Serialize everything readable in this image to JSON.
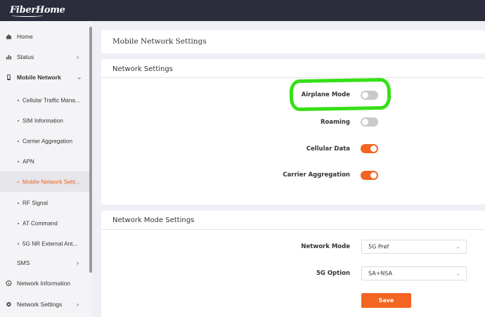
{
  "brand": {
    "logo_text": "FiberHome"
  },
  "sidebar": {
    "items": [
      {
        "label": "Home",
        "icon": "home-icon"
      },
      {
        "label": "Status",
        "icon": "bar-chart-icon"
      },
      {
        "label": "Mobile Network",
        "icon": "phone-icon"
      },
      {
        "label": "Network Information",
        "icon": "network-info-icon"
      },
      {
        "label": "Network Settings",
        "icon": "gear-icon"
      }
    ],
    "mobile_network_sub": [
      "Cellular Traffic Mana...",
      "SIM Information",
      "Carrier Aggregation",
      "APN",
      "Mobile Network Setti...",
      "RF Signal",
      "AT Command",
      "5G NR External Ant..."
    ],
    "sms_label": "SMS",
    "accent_color": "#f26522"
  },
  "page": {
    "title": "Mobile Network Settings",
    "network_settings": {
      "heading": "Network Settings",
      "rows": [
        {
          "label": "Airplane Mode",
          "state": "off"
        },
        {
          "label": "Roaming",
          "state": "off"
        },
        {
          "label": "Cellular Data",
          "state": "on"
        },
        {
          "label": "Carrier Aggregation",
          "state": "on"
        }
      ]
    },
    "network_mode_settings": {
      "heading": "Network Mode Settings",
      "network_mode_label": "Network Mode",
      "network_mode_value": "5G Pref",
      "option_label": "5G Option",
      "option_value": "SA+NSA",
      "save_label": "Save"
    }
  },
  "annotation_color": "#35e016"
}
